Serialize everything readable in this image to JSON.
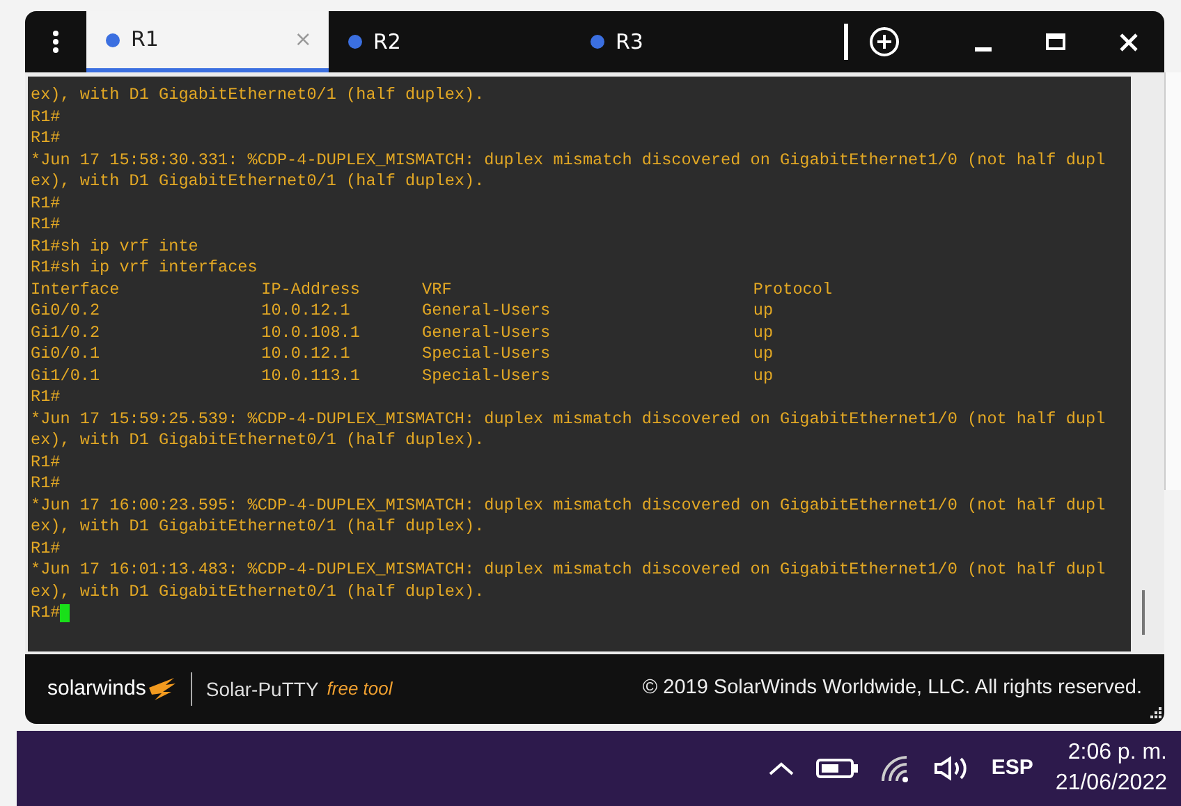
{
  "tabs": [
    {
      "label": "R1",
      "selected": true,
      "color": "#3b6fe0",
      "close": "×"
    },
    {
      "label": "R2",
      "selected": false,
      "color": "#3b6fe0"
    },
    {
      "label": "R3",
      "selected": false,
      "color": "#3b6fe0"
    }
  ],
  "terminal": {
    "before": [
      "ex), with D1 GigabitEthernet0/1 (half duplex).",
      "R1#",
      "R1#",
      "*Jun 17 15:58:30.331: %CDP-4-DUPLEX_MISMATCH: duplex mismatch discovered on GigabitEthernet1/0 (not half dupl",
      "ex), with D1 GigabitEthernet0/1 (half duplex).",
      "R1#",
      "R1#",
      "R1#sh ip vrf inte",
      "R1#sh ip vrf interfaces"
    ],
    "table": {
      "columns": [
        "Interface",
        "IP-Address",
        "VRF",
        "Protocol"
      ],
      "rows": [
        [
          "Gi0/0.2",
          "10.0.12.1",
          "General-Users",
          "up"
        ],
        [
          "Gi1/0.2",
          "10.0.108.1",
          "General-Users",
          "up"
        ],
        [
          "Gi0/0.1",
          "10.0.12.1",
          "Special-Users",
          "up"
        ],
        [
          "Gi1/0.1",
          "10.0.113.1",
          "Special-Users",
          "up"
        ]
      ]
    },
    "after": [
      "R1#",
      "*Jun 17 15:59:25.539: %CDP-4-DUPLEX_MISMATCH: duplex mismatch discovered on GigabitEthernet1/0 (not half dupl",
      "ex), with D1 GigabitEthernet0/1 (half duplex).",
      "R1#",
      "R1#",
      "*Jun 17 16:00:23.595: %CDP-4-DUPLEX_MISMATCH: duplex mismatch discovered on GigabitEthernet1/0 (not half dupl",
      "ex), with D1 GigabitEthernet0/1 (half duplex).",
      "R1#",
      "*Jun 17 16:01:13.483: %CDP-4-DUPLEX_MISMATCH: duplex mismatch discovered on GigabitEthernet1/0 (not half dupl",
      "ex), with D1 GigabitEthernet0/1 (half duplex)."
    ],
    "prompt": "R1#"
  },
  "footer": {
    "brand": "solarwinds",
    "product": "Solar-PuTTY",
    "edition": "free tool",
    "copyright": "© 2019 SolarWinds Worldwide, LLC. All rights reserved."
  },
  "taskbar": {
    "language": "ESP",
    "time": "2:06 p. m.",
    "date": "21/06/2022"
  }
}
